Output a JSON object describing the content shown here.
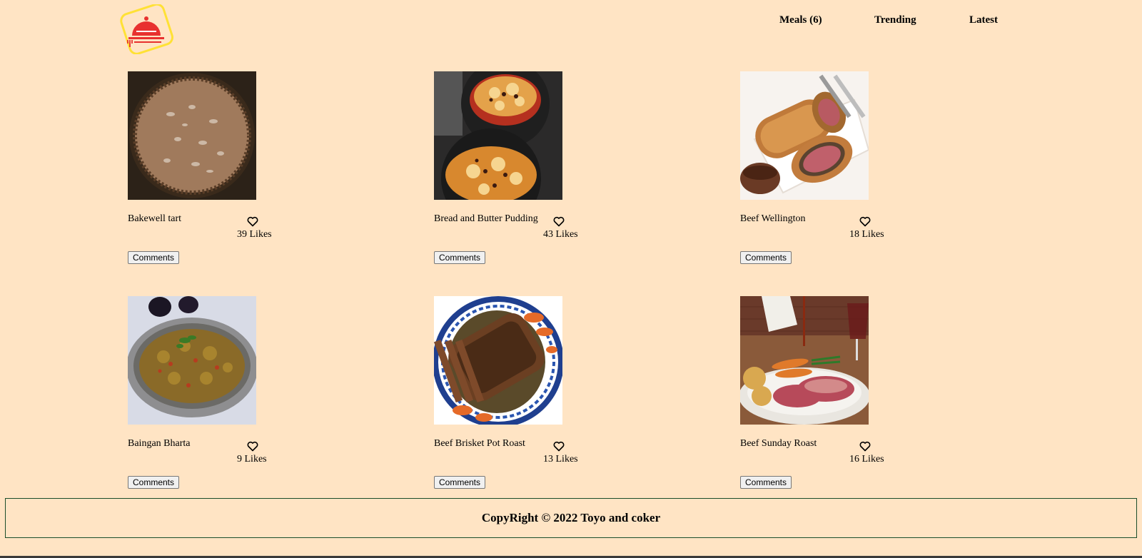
{
  "header": {
    "logo_icon": "meal-cloche-icon",
    "nav": [
      {
        "label": "Meals (6)"
      },
      {
        "label": "Trending"
      },
      {
        "label": "Latest"
      }
    ]
  },
  "meals": [
    {
      "title": "Bakewell tart",
      "likes": "39 Likes",
      "comments_label": "Comments",
      "image": "tart-photo"
    },
    {
      "title": "Bread and Butter Pudding",
      "likes": "43 Likes",
      "comments_label": "Comments",
      "image": "pudding-photo"
    },
    {
      "title": "Beef Wellington",
      "likes": "18 Likes",
      "comments_label": "Comments",
      "image": "wellington-photo"
    },
    {
      "title": "Baingan Bharta",
      "likes": "9 Likes",
      "comments_label": "Comments",
      "image": "bharta-photo"
    },
    {
      "title": "Beef Brisket Pot Roast",
      "likes": "13 Likes",
      "comments_label": "Comments",
      "image": "brisket-photo"
    },
    {
      "title": "Beef Sunday Roast",
      "likes": "16 Likes",
      "comments_label": "Comments",
      "image": "roast-photo"
    }
  ],
  "footer": {
    "copyright": "CopyRight © 2022 Toyo and coker"
  },
  "colors": {
    "background": "#ffe4c4",
    "footer_border": "#1b4d2a",
    "logo_red": "#e8312f",
    "logo_yellow": "#ffe135"
  }
}
